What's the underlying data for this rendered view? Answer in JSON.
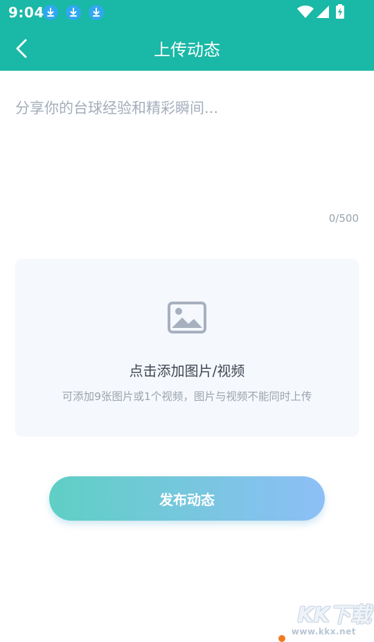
{
  "status_bar": {
    "time": "9:04",
    "notification_icons": [
      "download-icon",
      "download-icon",
      "download-icon"
    ],
    "system_icons": [
      "wifi-icon",
      "signal-icon",
      "battery-charging-icon"
    ]
  },
  "header": {
    "back_icon": "chevron-left-icon",
    "title": "上传动态"
  },
  "post_input": {
    "value": "",
    "placeholder": "分享你的台球经验和精彩瞬间...",
    "counter": "0/500"
  },
  "media_upload": {
    "icon": "image-icon",
    "title": "点击添加图片/视频",
    "hint": "可添加9张图片或1个视频，图片与视频不能同时上传"
  },
  "publish_button": {
    "label": "发布动态"
  },
  "watermark": {
    "text": "KK下载",
    "url": "www.kkx.net"
  },
  "colors": {
    "primary": "#1ab8a6",
    "button_gradient_start": "#5fcfc4",
    "button_gradient_end": "#8dbff7",
    "upload_bg": "#f5f8fc"
  }
}
